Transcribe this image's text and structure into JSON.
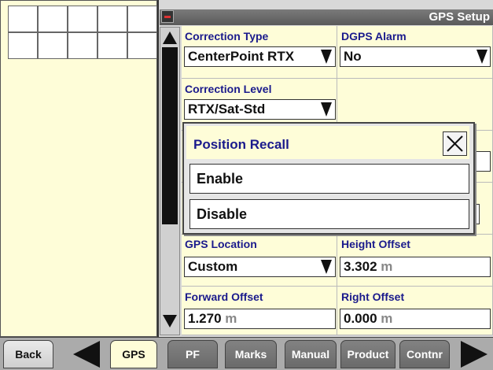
{
  "header": {
    "title": "GPS Setup",
    "icon": "gps-settings-icon"
  },
  "fields": {
    "correction_type": {
      "label": "Correction Type",
      "value": "CenterPoint RTX"
    },
    "dgps_alarm": {
      "label": "DGPS Alarm",
      "value": "No"
    },
    "correction_level": {
      "label": "Correction Level",
      "value": "RTX/Sat-Std"
    },
    "gps_location": {
      "label": "GPS Location",
      "value": "Custom"
    },
    "height_offset": {
      "label": "Height Offset",
      "value": "3.302",
      "unit": "m"
    },
    "forward_offset": {
      "label": "Forward Offset",
      "value": "1.270",
      "unit": "m"
    },
    "right_offset": {
      "label": "Right Offset",
      "value": "0.000",
      "unit": "m"
    }
  },
  "dialog": {
    "title": "Position Recall",
    "options": [
      "Enable",
      "Disable"
    ]
  },
  "bottombar": {
    "back": "Back",
    "gps": "GPS",
    "pf": "PF",
    "marks": "Marks",
    "manual": "Manual",
    "product": "Product",
    "contnr": "Contnr"
  },
  "colors": {
    "label": "#1a1a8c",
    "panel": "#fefdd8",
    "unit": "#888888"
  }
}
